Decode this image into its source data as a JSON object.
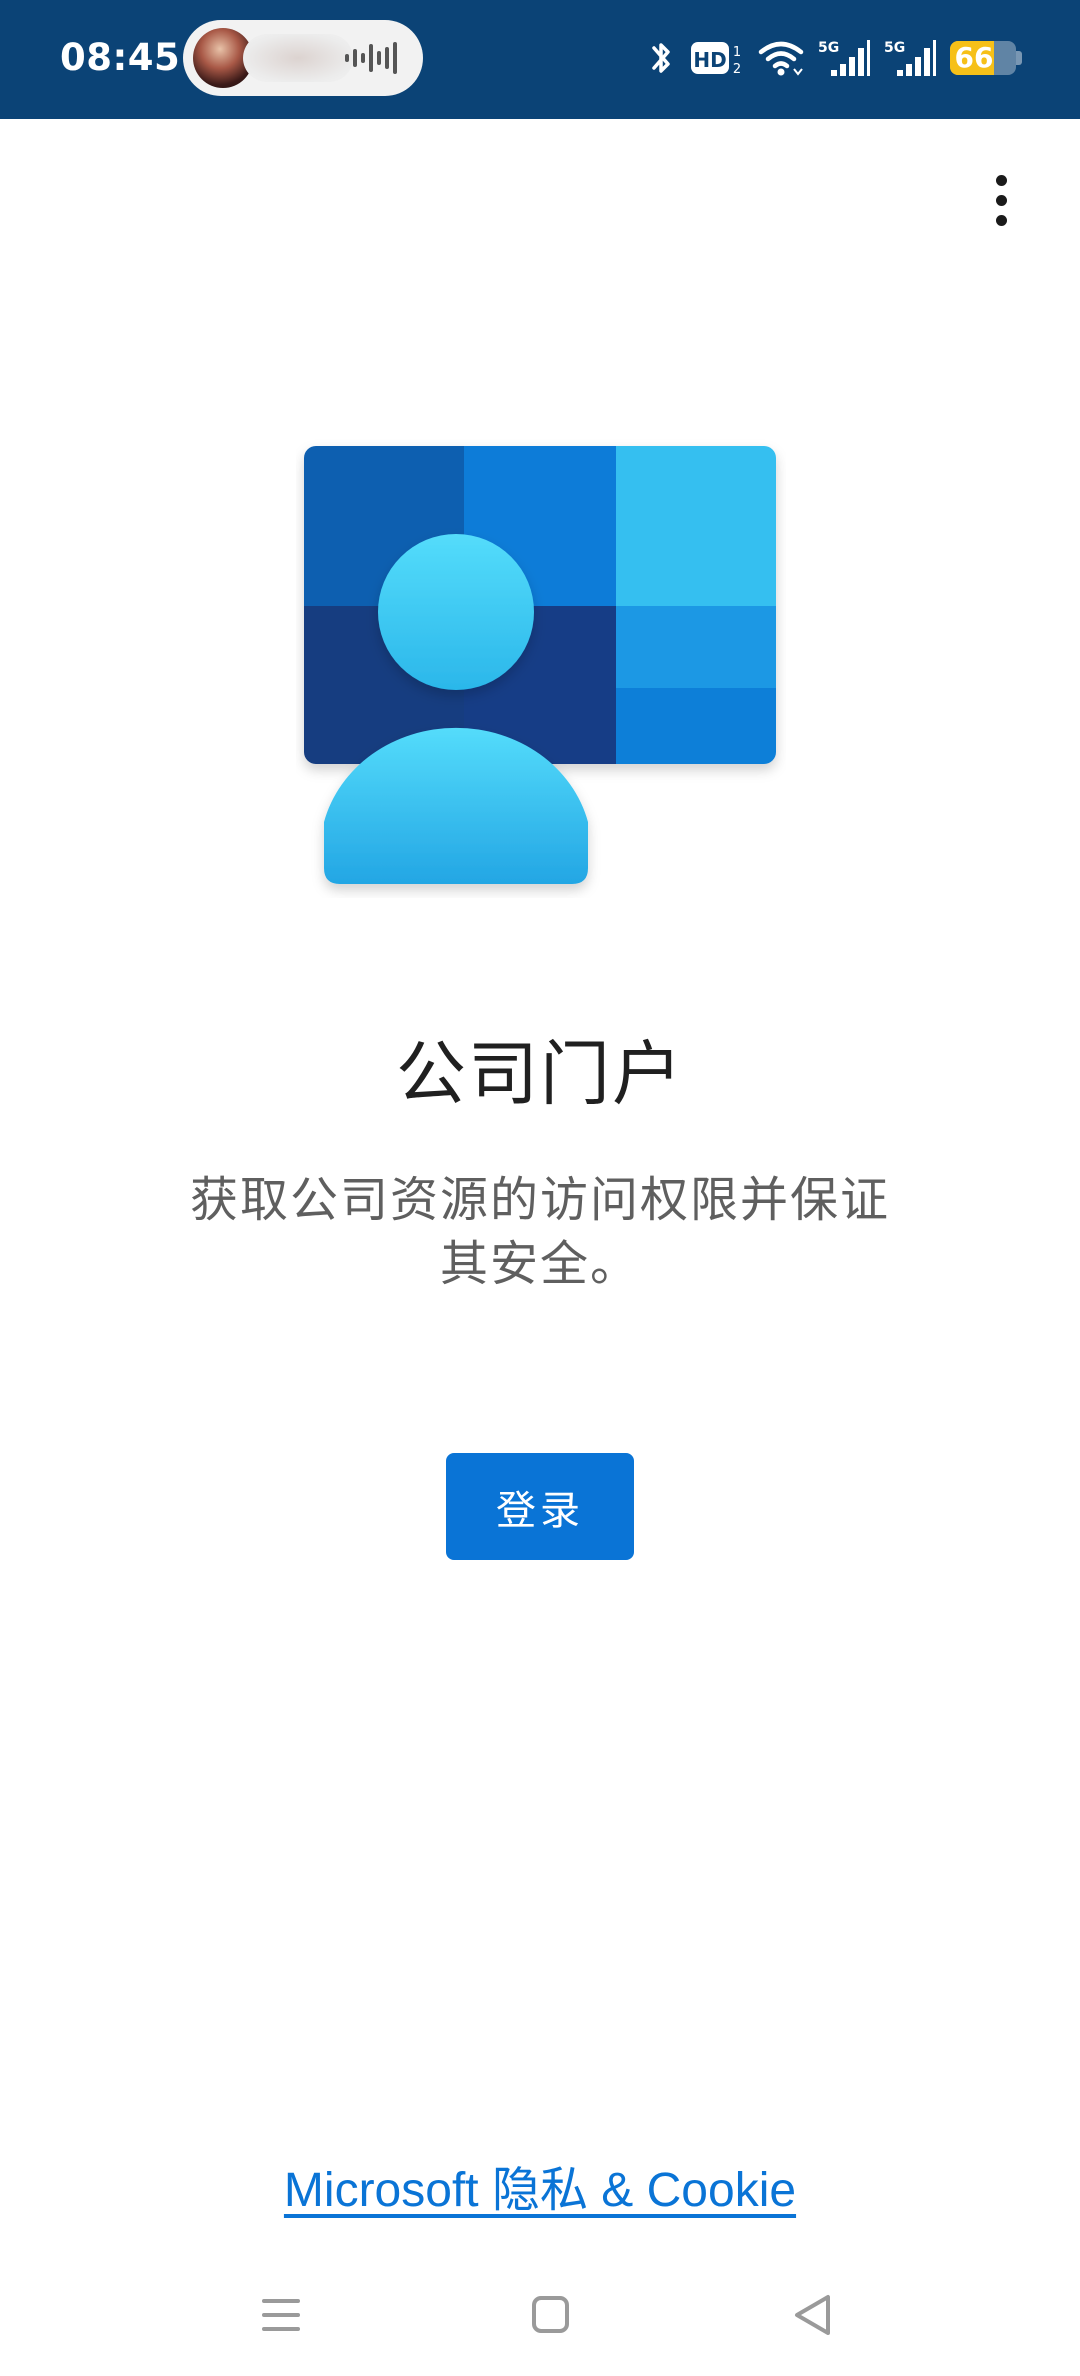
{
  "status_bar": {
    "time": "08:45",
    "battery_level": "66",
    "icons": [
      "bluetooth-icon",
      "hd-voice-icon",
      "wifi-icon",
      "signal-5g-icon",
      "signal-5g-icon",
      "battery-icon"
    ],
    "call_pill_icon": "voice-wave-icon"
  },
  "app_bar": {
    "menu_icon": "more-vertical-icon"
  },
  "main": {
    "logo_icon": "company-portal-logo",
    "title": "公司门户",
    "description": "获取公司资源的访问权限并保证其安全。",
    "signin_label": "登录"
  },
  "footer": {
    "privacy_link": "Microsoft 隐私 & Cookie"
  },
  "nav_bar": {
    "icons": [
      "menu-icon",
      "home-icon",
      "back-icon"
    ]
  },
  "colors": {
    "status_bar": "#0b4376",
    "accent": "#0a74d6",
    "title_text": "#202020",
    "body_text": "#5f5f5f",
    "battery": "#f6c018"
  }
}
